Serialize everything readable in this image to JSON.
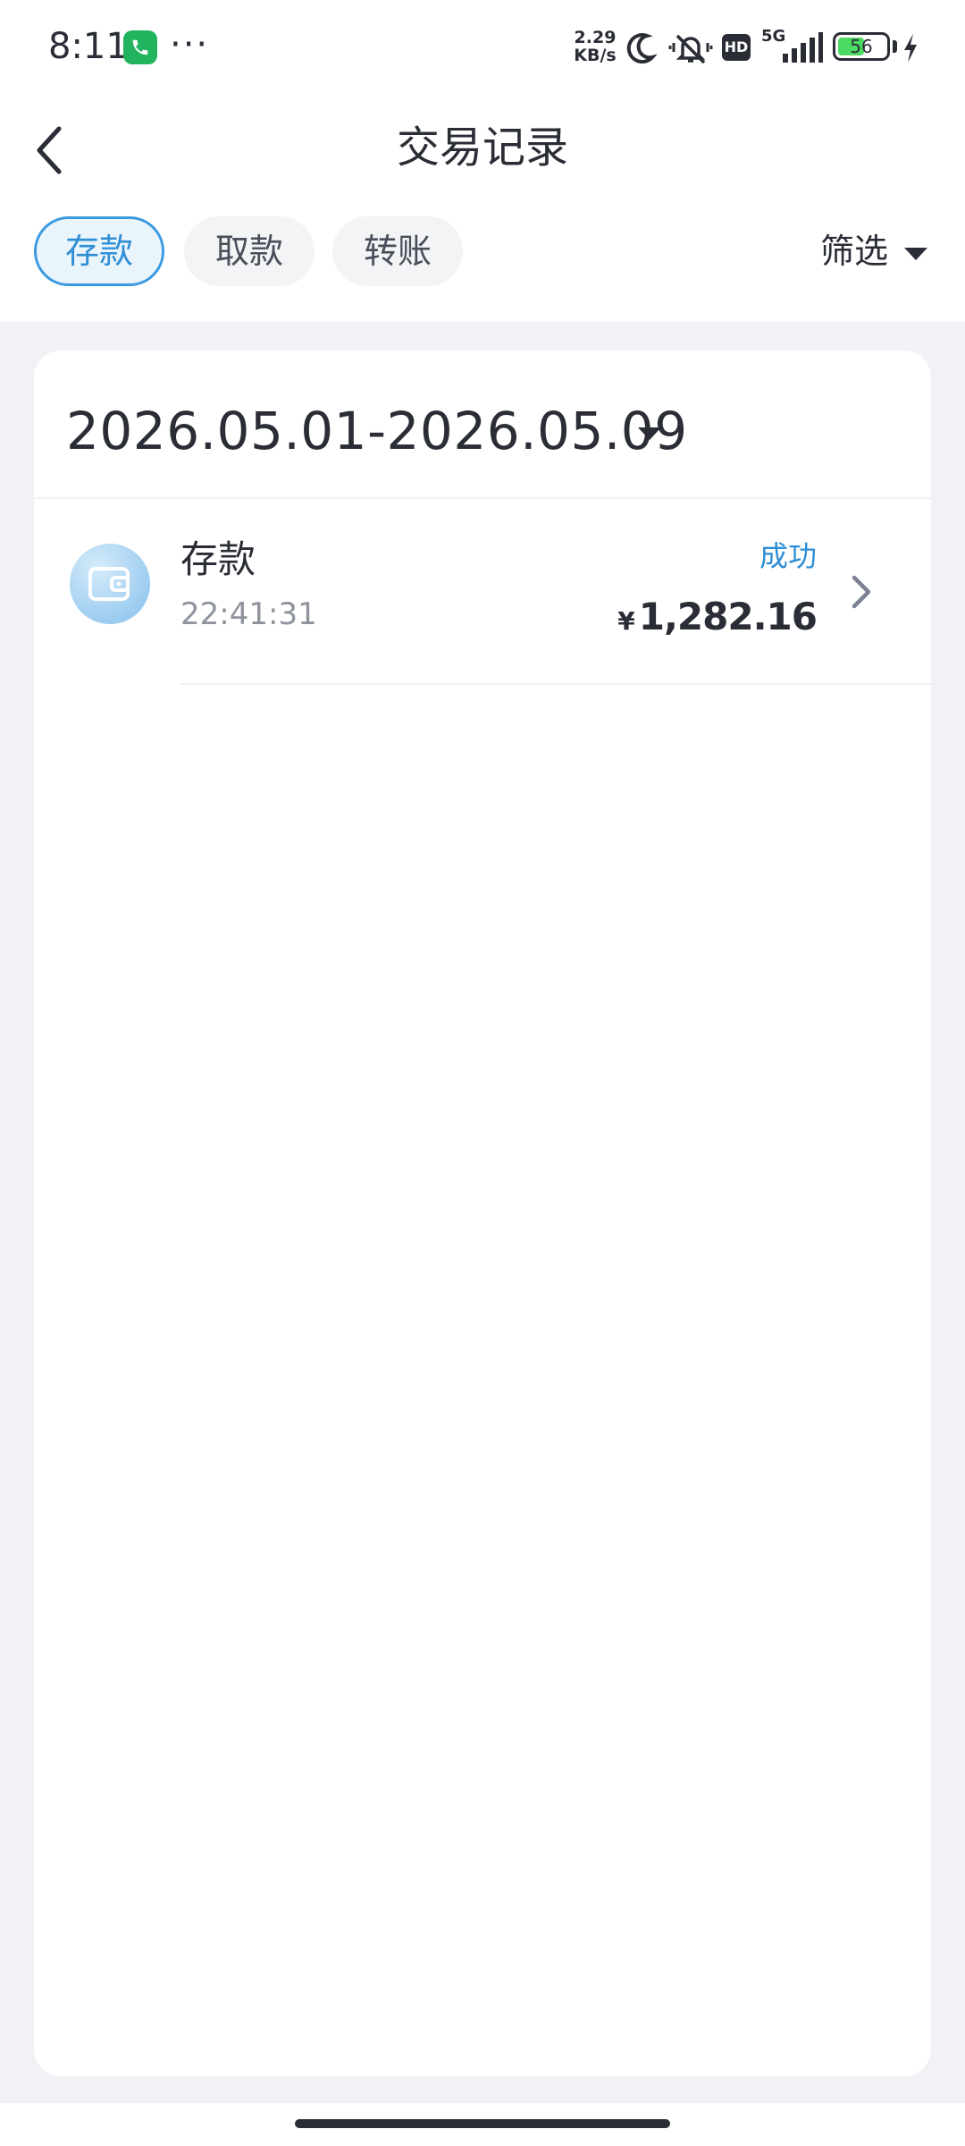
{
  "status_bar": {
    "time": "8:11",
    "more_dots": "···",
    "net_speed_value": "2.29",
    "net_speed_unit": "KB/s",
    "hd_label": "HD",
    "network_label": "5G",
    "battery_level": "56",
    "icons": [
      "phone-call-icon",
      "moon-icon",
      "silent-bell-icon",
      "signal-icon",
      "battery-icon",
      "charging-bolt-icon"
    ]
  },
  "nav": {
    "title": "交易记录",
    "back_icon": "chevron-left-icon"
  },
  "tabs": [
    {
      "label": "存款",
      "active": true
    },
    {
      "label": "取款",
      "active": false
    },
    {
      "label": "转账",
      "active": false
    }
  ],
  "filter": {
    "label": "筛选",
    "icon": "caret-down-icon"
  },
  "date_range": "2026.05.01-2026.05.09",
  "transactions": [
    {
      "title": "存款",
      "time": "22:41:31",
      "status": "成功",
      "currency": "¥",
      "amount": "1,282.16",
      "icon": "wallet-icon"
    }
  ],
  "colors": {
    "accent": "#2f8fd6",
    "page_background": "#f1f2f6",
    "text_primary": "#2a2d36",
    "text_secondary": "#8f939e",
    "battery_fill": "#4cd964",
    "call_badge": "#22b35e"
  }
}
